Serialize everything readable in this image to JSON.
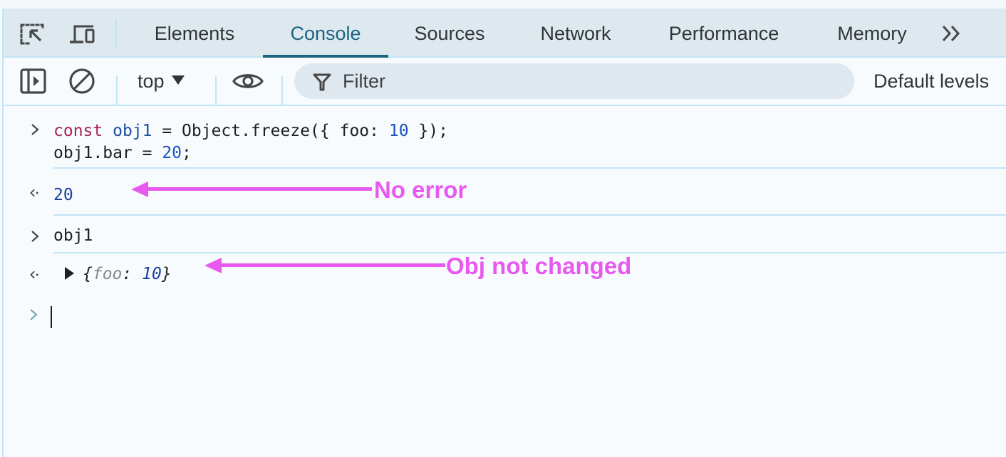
{
  "tabbar": {
    "tabs": [
      {
        "label": "Elements",
        "active": false
      },
      {
        "label": "Console",
        "active": true
      },
      {
        "label": "Sources",
        "active": false
      },
      {
        "label": "Network",
        "active": false
      },
      {
        "label": "Performance",
        "active": false
      },
      {
        "label": "Memory",
        "active": false
      }
    ],
    "icons": {
      "inspect": "inspect-element-icon",
      "device": "device-toolbar-icon",
      "more": "more-tabs-chevron-icon"
    }
  },
  "toolbar": {
    "sidebar_icon": "show-sidebar-icon",
    "clear_icon": "clear-console-icon",
    "context": "top",
    "eye_icon": "live-expression-eye-icon",
    "filter_placeholder": "Filter",
    "filter_value": "",
    "levels_label": "Default levels"
  },
  "console": {
    "entries": [
      {
        "type": "input",
        "lines": [
          "const obj1 = Object.freeze({ foo: 10 });",
          "obj1.bar = 20;"
        ]
      },
      {
        "type": "output",
        "value": "20"
      },
      {
        "type": "input",
        "lines": [
          "obj1"
        ]
      },
      {
        "type": "output",
        "object": {
          "open": "{",
          "key": "foo",
          "colon": ":",
          "value": "10",
          "close": "}"
        }
      }
    ],
    "tokens": {
      "const": "const",
      "obj1": "obj1",
      "eq_object_freeze": " = Object.freeze({ foo: ",
      "ten": "10",
      "close_call": " });",
      "line2_prefix": "obj1.bar = ",
      "twenty": "20",
      "semicolon": ";"
    }
  },
  "annotations": [
    {
      "text": "No error",
      "color": "#e859f0"
    },
    {
      "text": "Obj not changed",
      "color": "#e859f0"
    }
  ]
}
